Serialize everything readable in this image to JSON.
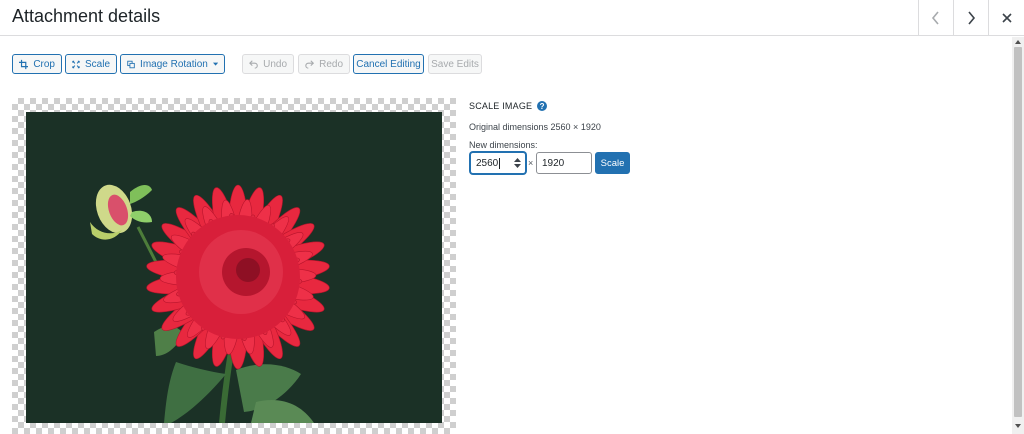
{
  "header": {
    "title": "Attachment details",
    "prev_icon": "chevron-left-icon",
    "next_icon": "chevron-right-icon",
    "close_icon": "close-icon"
  },
  "toolbar": {
    "crop_label": "Crop",
    "scale_label": "Scale",
    "rotation_label": "Image Rotation",
    "undo_label": "Undo",
    "redo_label": "Redo",
    "cancel_label": "Cancel Editing",
    "save_label": "Save Edits"
  },
  "scale_panel": {
    "heading": "SCALE IMAGE",
    "help_glyph": "?",
    "original_dimensions": "Original dimensions 2560 × 1920",
    "new_dimensions_label": "New dimensions:",
    "width_value": "2560",
    "height_value": "1920",
    "times_sign": "×",
    "scale_button_label": "Scale"
  },
  "colors": {
    "accent": "#2271b1",
    "photo_background": "#1b3126",
    "flower": "#e3263f"
  }
}
